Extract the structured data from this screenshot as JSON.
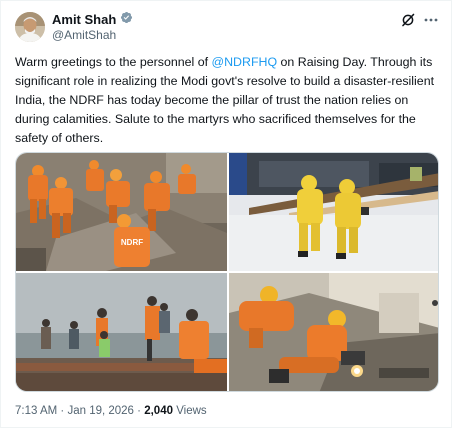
{
  "author": {
    "display_name": "Amit Shah",
    "handle": "@AmitShah"
  },
  "tweet": {
    "text_before": "Warm greetings to the personnel of ",
    "mention": "@NDRFHQ",
    "text_after": " on Raising Day. Through its significant role in realizing the Modi govt's resolve to build a disaster-resilient India, the NDRF has today become the pillar of trust the nation relies on during calamities. Salute to the martyrs who sacrificed themselves for the safety of others."
  },
  "meta": {
    "time": "7:13 AM",
    "separator": "·",
    "date": "Jan 19, 2026",
    "views_count": "2,040",
    "views_label": "Views"
  },
  "photos": [
    {
      "label": "NDRF"
    },
    {
      "label": ""
    },
    {
      "label": ""
    },
    {
      "label": ""
    }
  ],
  "icons": {
    "verified": "verified-badge-icon",
    "grok": "grok-icon",
    "more": "more-icon"
  },
  "colors": {
    "accent": "#1d9bf0",
    "text": "#0f1419",
    "secondary": "#536471",
    "ndrf_orange": "#e8782a"
  }
}
